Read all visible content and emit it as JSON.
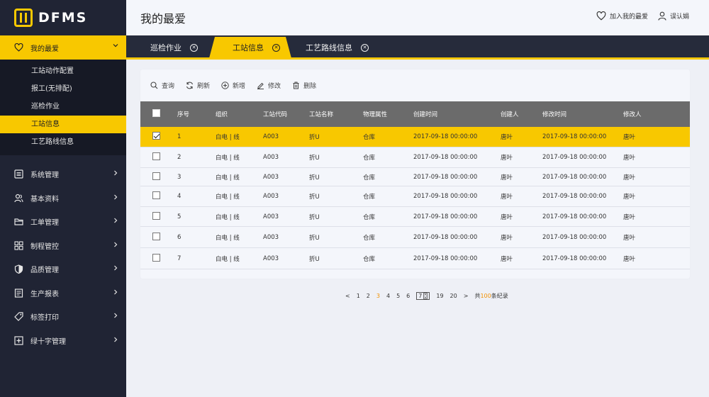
{
  "app": {
    "logo_text": "DFMS"
  },
  "sidebar": {
    "favorite": {
      "label": "我的最爱",
      "icon": "heart-icon"
    },
    "sub_items": [
      {
        "label": "工站动作配置"
      },
      {
        "label": "报工(无排配)"
      },
      {
        "label": "巡检作业"
      },
      {
        "label": "工站信息",
        "active": true
      },
      {
        "label": "工艺路线信息"
      }
    ],
    "items": [
      {
        "label": "系统管理",
        "icon": "list-icon"
      },
      {
        "label": "基本资料",
        "icon": "users-icon"
      },
      {
        "label": "工单管理",
        "icon": "folder-icon"
      },
      {
        "label": "制程管控",
        "icon": "grid-icon"
      },
      {
        "label": "品质管理",
        "icon": "shield-icon"
      },
      {
        "label": "生产报表",
        "icon": "report-icon"
      },
      {
        "label": "标签打印",
        "icon": "tag-icon"
      },
      {
        "label": "绿十字管理",
        "icon": "plus-box-icon"
      }
    ]
  },
  "header": {
    "title": "我的最爱",
    "add_favorite": "加入我的最爱",
    "user": "误认娟"
  },
  "tabs": [
    {
      "label": "巡检作业",
      "active": false
    },
    {
      "label": "工站信息",
      "active": true
    },
    {
      "label": "工艺路线信息",
      "active": false
    }
  ],
  "toolbar": {
    "query": "查询",
    "refresh": "刷新",
    "add": "新增",
    "edit": "修改",
    "delete": "删除"
  },
  "table": {
    "columns": [
      "序号",
      "组织",
      "工站代码",
      "工站名称",
      "物理属性",
      "创建时间",
      "创建人",
      "修改时间",
      "修改人"
    ],
    "rows": [
      {
        "checked": true,
        "cells": [
          "1",
          "白电 | 线",
          "A003",
          "折U",
          "仓库",
          "2017-09-18 00:00:00",
          "唐叶",
          "2017-09-18 00:00:00",
          "唐叶"
        ]
      },
      {
        "checked": false,
        "cells": [
          "2",
          "白电 | 线",
          "A003",
          "折U",
          "仓库",
          "2017-09-18 00:00:00",
          "唐叶",
          "2017-09-18 00:00:00",
          "唐叶"
        ]
      },
      {
        "checked": false,
        "cells": [
          "3",
          "白电 | 线",
          "A003",
          "折U",
          "仓库",
          "2017-09-18 00:00:00",
          "唐叶",
          "2017-09-18 00:00:00",
          "唐叶"
        ]
      },
      {
        "checked": false,
        "cells": [
          "4",
          "白电 | 线",
          "A003",
          "折U",
          "仓库",
          "2017-09-18 00:00:00",
          "唐叶",
          "2017-09-18 00:00:00",
          "唐叶"
        ]
      },
      {
        "checked": false,
        "cells": [
          "5",
          "白电 | 线",
          "A003",
          "折U",
          "仓库",
          "2017-09-18 00:00:00",
          "唐叶",
          "2017-09-18 00:00:00",
          "唐叶"
        ]
      },
      {
        "checked": false,
        "cells": [
          "6",
          "白电 | 线",
          "A003",
          "折U",
          "仓库",
          "2017-09-18 00:00:00",
          "唐叶",
          "2017-09-18 00:00:00",
          "唐叶"
        ]
      },
      {
        "checked": false,
        "cells": [
          "7",
          "白电 | 线",
          "A003",
          "折U",
          "仓库",
          "2017-09-18 00:00:00",
          "唐叶",
          "2017-09-18 00:00:00",
          "唐叶"
        ]
      }
    ]
  },
  "pagination": {
    "prev": "<",
    "pages": [
      "1",
      "2",
      "3",
      "4",
      "5",
      "6"
    ],
    "current": "3",
    "jump_value": "7",
    "after": [
      "19",
      "20"
    ],
    "next": ">",
    "total_prefix": "共",
    "total_count": "100",
    "total_suffix": "条纪录"
  },
  "colors": {
    "accent": "#f8c800",
    "sidebar_bg": "#202434",
    "table_header": "#6b6b6b",
    "page_current": "#f29100"
  }
}
